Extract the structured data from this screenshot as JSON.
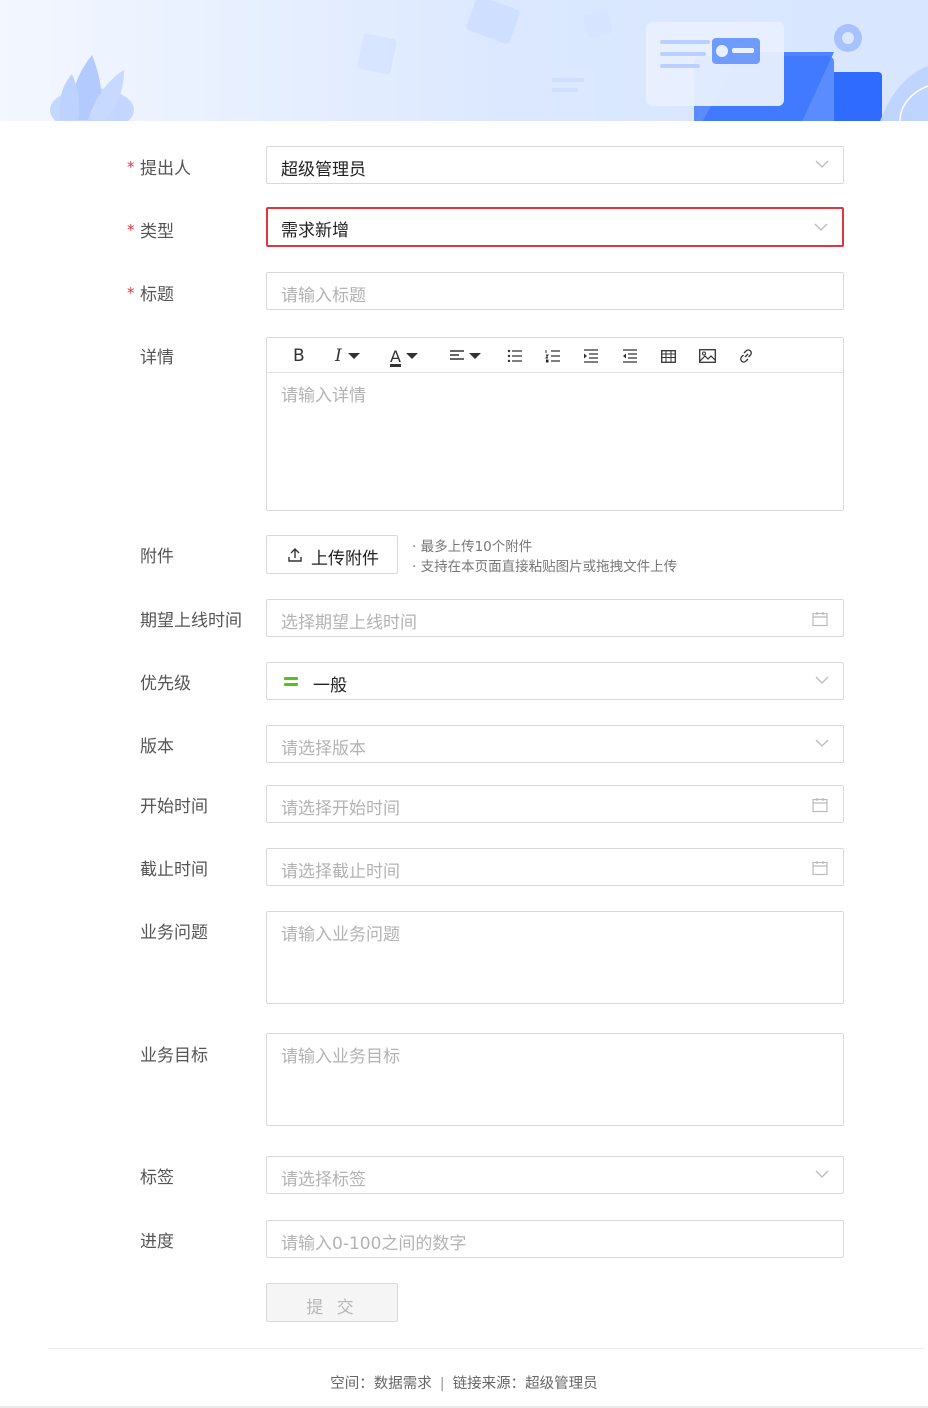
{
  "form": {
    "proposer": {
      "label": "提出人",
      "value": "超级管理员",
      "required": true
    },
    "type": {
      "label": "类型",
      "value": "需求新增",
      "required": true
    },
    "title": {
      "label": "标题",
      "placeholder": "请输入标题",
      "required": true
    },
    "detail": {
      "label": "详情",
      "placeholder": "请输入详情",
      "toolbar": [
        "bold-icon",
        "italic-icon",
        "font-color-icon",
        "align-icon",
        "bullet-list-icon",
        "ordered-list-icon",
        "indent-icon",
        "outdent-icon",
        "table-icon",
        "image-icon",
        "link-icon"
      ],
      "bold_glyph": "B",
      "italic_glyph": "I",
      "color_glyph": "A"
    },
    "attachment": {
      "label": "附件",
      "button": "上传附件",
      "hints": [
        "最多上传10个附件",
        "支持在本页面直接粘贴图片或拖拽文件上传"
      ]
    },
    "expected_online": {
      "label": "期望上线时间",
      "placeholder": "选择期望上线时间"
    },
    "priority": {
      "label": "优先级",
      "value": "一般",
      "color": "#52c41a"
    },
    "version": {
      "label": "版本",
      "placeholder": "请选择版本"
    },
    "start_time": {
      "label": "开始时间",
      "placeholder": "请选择开始时间"
    },
    "end_time": {
      "label": "截止时间",
      "placeholder": "请选择截止时间"
    },
    "business_problem": {
      "label": "业务问题",
      "placeholder": "请输入业务问题"
    },
    "business_goal": {
      "label": "业务目标",
      "placeholder": "请输入业务目标"
    },
    "tags": {
      "label": "标签",
      "placeholder": "请选择标签"
    },
    "progress": {
      "label": "进度",
      "placeholder": "请输入0-100之间的数字"
    },
    "submit": "提 交"
  },
  "footer": {
    "space": "空间：数据需求",
    "separator": "|",
    "source": "链接来源：超级管理员"
  },
  "colors": {
    "required": "#e5363d",
    "focus_border": "#e0363f",
    "banner": "#dbe8ff"
  }
}
